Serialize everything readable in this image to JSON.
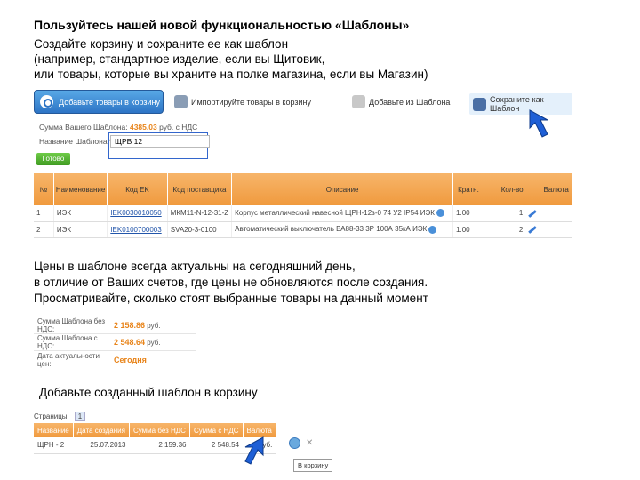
{
  "heading": "Пользуйтесь нашей новой функциональностью «Шаблоны»",
  "intro": [
    "Создайте корзину и сохраните ее как шаблон",
    "(например, стандартное изделие, если вы Щитовик,",
    "или товары, которые вы храните на полке магазина, если вы Магазин)"
  ],
  "shot1": {
    "toolbar": {
      "add_label": "Добавьте товары в корзину",
      "import_label": "Импортируйте товары в корзину",
      "add_template_label": "Добавьте из Шаблона",
      "save_template_label": "Сохраните как Шаблон"
    },
    "sum_label": "Сумма Вашего Шаблона:",
    "sum_value": "4385.03",
    "sum_suffix": "руб. с НДС",
    "name_label": "Название Шаблона *:",
    "name_value": "ЩРВ 12",
    "ok_label": "Готово",
    "columns": [
      "№",
      "Наименование",
      "Код EK",
      "Код поставщика",
      "Описание",
      "Кратн.",
      "Кол-во",
      "Валюта"
    ],
    "rows": [
      {
        "num": "1",
        "brand": "ИЭК",
        "code": "IEK0030010050",
        "supplier_code": "МКМ11-N-12-31-Z",
        "desc": "Корпус металлический навесной ЩРН-12з-0 74 У2 IP54 ИЭК",
        "mult": "1.00",
        "qty": "1"
      },
      {
        "num": "2",
        "brand": "ИЭК",
        "code": "IEK0100700003",
        "supplier_code": "SVA20-3-0100",
        "desc": "Автоматический выключатель ВА88-33 3Р 100А 35кА ИЭК",
        "mult": "1.00",
        "qty": "2"
      }
    ]
  },
  "middle_text": [
    "Цены в шаблоне всегда актуальны на сегодняшний день,",
    "в отличие от Ваших счетов, где цены не обновляются после создания.",
    "Просматривайте, сколько стоят выбранные товары на данный момент"
  ],
  "shot2": {
    "sum_no_vat_label": "Сумма Шаблона без НДС:",
    "sum_no_vat_value": "2 158.86",
    "sum_no_vat_unit": "руб.",
    "sum_vat_label": "Сумма Шаблона с НДС:",
    "sum_vat_value": "2 548.64",
    "sum_vat_unit": "руб.",
    "date_label": "Дата актуальности цен:",
    "date_value": "Сегодня"
  },
  "add_text": "Добавьте созданный шаблон в корзину",
  "shot3": {
    "pages_label": "Страницы:",
    "page_number": "1",
    "columns": [
      "Название",
      "Дата создания",
      "Сумма без НДС",
      "Сумма с НДС",
      "Валюта"
    ],
    "row": {
      "name": "ЩРН - 2",
      "date": "25.07.2013",
      "sum_no_vat": "2 159.36",
      "sum_vat": "2 548.54",
      "currency": "руб."
    },
    "tooltip": "В корзину"
  },
  "colors": {
    "accent_orange": "#f09a3e",
    "value_orange": "#e8841a",
    "button_blue": "#2d74c5",
    "button_green": "#3f9b21",
    "arrow_blue": "#1e5fd6"
  }
}
